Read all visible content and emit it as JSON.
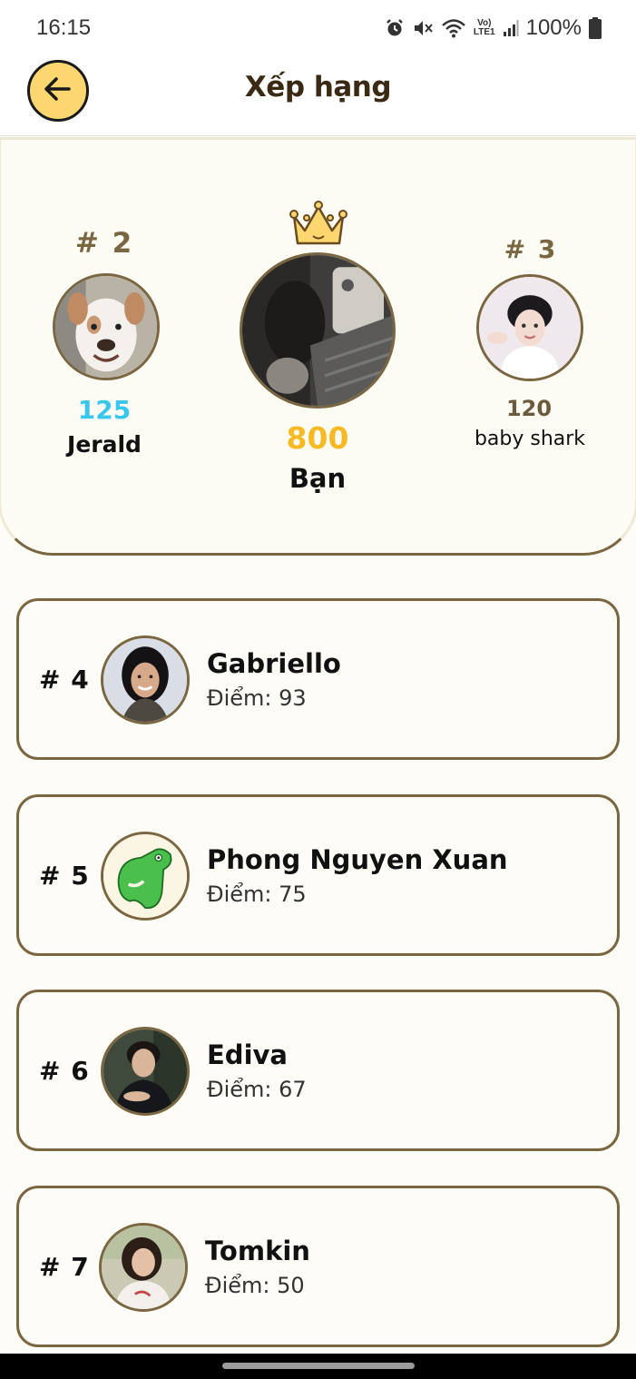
{
  "status_bar": {
    "time": "16:15",
    "battery": "100%",
    "lte_line1": "Vo)",
    "lte_line2": "LTE1",
    "icons": [
      "alarm-icon",
      "mute-icon",
      "wifi-icon",
      "lte-icon",
      "signal-icon",
      "battery-icon"
    ]
  },
  "header": {
    "title": "Xếp hạng",
    "back_icon": "arrow-left-icon"
  },
  "podium": {
    "first": {
      "rank": "",
      "score": "800",
      "name": "Bạn",
      "crown_icon": "crown-icon"
    },
    "second": {
      "rank": "# 2",
      "score": "125",
      "name": "Jerald"
    },
    "third": {
      "rank": "# 3",
      "score": "120",
      "name": "baby shark"
    }
  },
  "leaderboard": [
    {
      "rank": "# 4",
      "name": "Gabriello",
      "score": "Điểm: 93"
    },
    {
      "rank": "# 5",
      "name": "Phong Nguyen Xuan",
      "score": "Điểm: 75"
    },
    {
      "rank": "# 6",
      "name": "Ediva",
      "score": "Điểm: 67"
    },
    {
      "rank": "# 7",
      "name": "Tomkin",
      "score": "Điểm: 50"
    }
  ],
  "colors": {
    "accent": "#fcd66f",
    "border": "#7a6641",
    "first_score": "#f7b924",
    "second_score": "#38c6ec",
    "third_score": "#6b5a3e",
    "background": "#fdfcf6"
  }
}
